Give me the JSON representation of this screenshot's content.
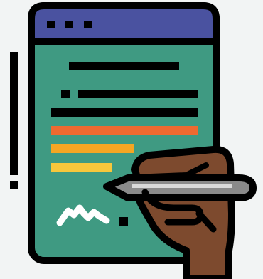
{
  "illustration": {
    "subject": "document-signing-icon",
    "colors": {
      "background": "#f2f4f4",
      "outline": "#000000",
      "window_bar": "#4a52a0",
      "document": "#3f9a82",
      "line_orange": "#ef6a30",
      "line_amber": "#f5a623",
      "line_yellow": "#f7c73c",
      "signature": "#ffffff",
      "skin": "#7d4a2e",
      "pen_body": "#8a8a8a",
      "pen_light": "#d9d9d9"
    }
  }
}
